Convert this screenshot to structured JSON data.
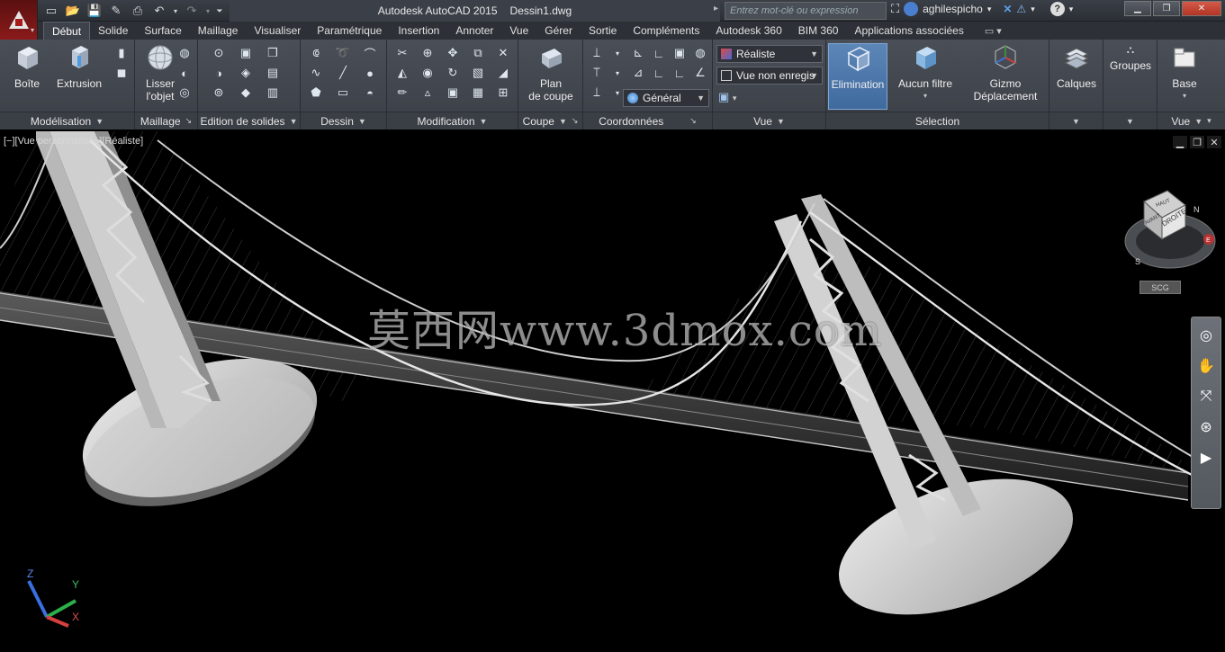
{
  "titlebar": {
    "app_title": "Autodesk AutoCAD 2015",
    "file_name": "Dessin1.dwg",
    "search_placeholder": "Entrez mot-clé ou expression",
    "username": "aghilespicho"
  },
  "tabs": [
    "Début",
    "Solide",
    "Surface",
    "Maillage",
    "Visualiser",
    "Paramétrique",
    "Insertion",
    "Annoter",
    "Vue",
    "Gérer",
    "Sortie",
    "Compléments",
    "Autodesk 360",
    "BIM 360",
    "Applications associées"
  ],
  "ribbon": {
    "modelisation": {
      "title": "Modélisation",
      "boite": "Boîte",
      "extrusion": "Extrusion"
    },
    "maillage": {
      "title": "Maillage",
      "lisser_1": "Lisser",
      "lisser_2": "l'objet"
    },
    "edition": {
      "title": "Edition de solides"
    },
    "dessin": {
      "title": "Dessin"
    },
    "modification": {
      "title": "Modification"
    },
    "coupe": {
      "title": "Coupe",
      "plan_1": "Plan",
      "plan_2": "de coupe"
    },
    "coordonnees": {
      "title": "Coordonnées",
      "ucs_dropdown": "Général"
    },
    "vue": {
      "title": "Vue",
      "style_dropdown": "Réaliste",
      "view_dropdown": "Vue non enregis"
    },
    "selection": {
      "title": "Sélection",
      "elimination": "Elimination",
      "aucun_filtre": "Aucun filtre",
      "gizmo_1": "Gizmo",
      "gizmo_2": "Déplacement"
    },
    "calques": {
      "title": "Calques"
    },
    "groupes": {
      "title": "Groupes"
    },
    "base": {
      "title": "Base",
      "vue_footer": "Vue"
    }
  },
  "viewport": {
    "label": "[−][Vue personnalisée][Réaliste]",
    "watermark": "莫西网www.3dmox.com",
    "viewcube_face": "DROITE",
    "viewcube_top": "HAUT",
    "viewcube_front": "AVANT",
    "compass_n": "N",
    "compass_s": "S",
    "compass_e": "E",
    "wcs_label": "SCG",
    "ucs_x": "X",
    "ucs_y": "Y",
    "ucs_z": "Z"
  },
  "colors": {
    "ribbon_bg": "#4a4f57",
    "accent_selected": "#5d86b8",
    "viewport_bg": "#000000"
  }
}
